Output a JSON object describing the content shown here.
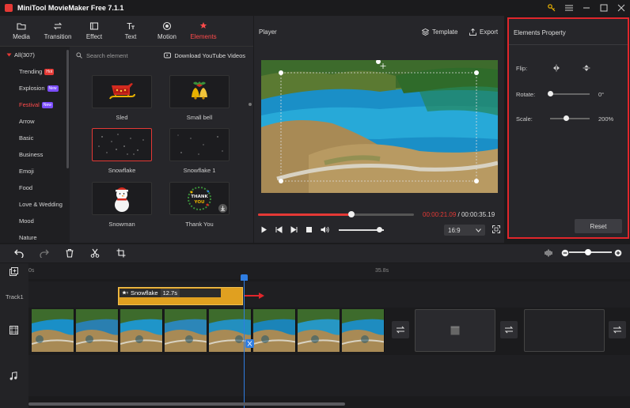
{
  "app": {
    "title": "MiniTool MovieMaker Free 7.1.1"
  },
  "tabs": [
    {
      "label": "Media",
      "icon": "folder-icon"
    },
    {
      "label": "Transition",
      "icon": "transition-icon"
    },
    {
      "label": "Effect",
      "icon": "effect-icon"
    },
    {
      "label": "Text",
      "icon": "text-icon"
    },
    {
      "label": "Motion",
      "icon": "motion-icon"
    },
    {
      "label": "Elements",
      "icon": "elements-icon",
      "active": true
    }
  ],
  "categories": [
    {
      "label": "All(307)"
    },
    {
      "label": "Trending",
      "badge": "Hot",
      "badge_color": "#e53935"
    },
    {
      "label": "Explosion",
      "badge": "New",
      "badge_color": "#7b4dff"
    },
    {
      "label": "Festival",
      "badge": "New",
      "badge_color": "#7b4dff",
      "active": true
    },
    {
      "label": "Arrow"
    },
    {
      "label": "Basic"
    },
    {
      "label": "Business"
    },
    {
      "label": "Emoji"
    },
    {
      "label": "Food"
    },
    {
      "label": "Love & Wedding"
    },
    {
      "label": "Mood"
    },
    {
      "label": "Nature"
    }
  ],
  "search": {
    "placeholder": "Search element"
  },
  "download_link": "Download YouTube Videos",
  "elements": [
    {
      "label": "Sled"
    },
    {
      "label": "Small bell"
    },
    {
      "label": "Snowflake",
      "selected": true
    },
    {
      "label": "Snowflake 1"
    },
    {
      "label": "Snowman"
    },
    {
      "label": "Thank You",
      "downloadable": true
    }
  ],
  "player": {
    "label": "Player",
    "template_label": "Template",
    "export_label": "Export",
    "current_time": "00:00:21.09",
    "separator": " / ",
    "total_time": "00:00:35.19",
    "progress": 0.6,
    "volume": 0.9,
    "aspect_ratio": "16:9"
  },
  "properties": {
    "title": "Elements Property",
    "flip_label": "Flip:",
    "rotate_label": "Rotate:",
    "rotate_value": "0°",
    "rotate_level": 0.0,
    "scale_label": "Scale:",
    "scale_value": "200%",
    "scale_level": 0.4,
    "reset_label": "Reset"
  },
  "timeline": {
    "ruler_start": "0s",
    "ruler_mark": "35.8s",
    "track1_label": "Track1",
    "clip_name": "Snowflake",
    "clip_duration": "12.7s",
    "zoom_level": 0.45
  },
  "colors": {
    "accent": "#e53935",
    "playhead": "#2f7de1",
    "clip": "#e0a020"
  }
}
